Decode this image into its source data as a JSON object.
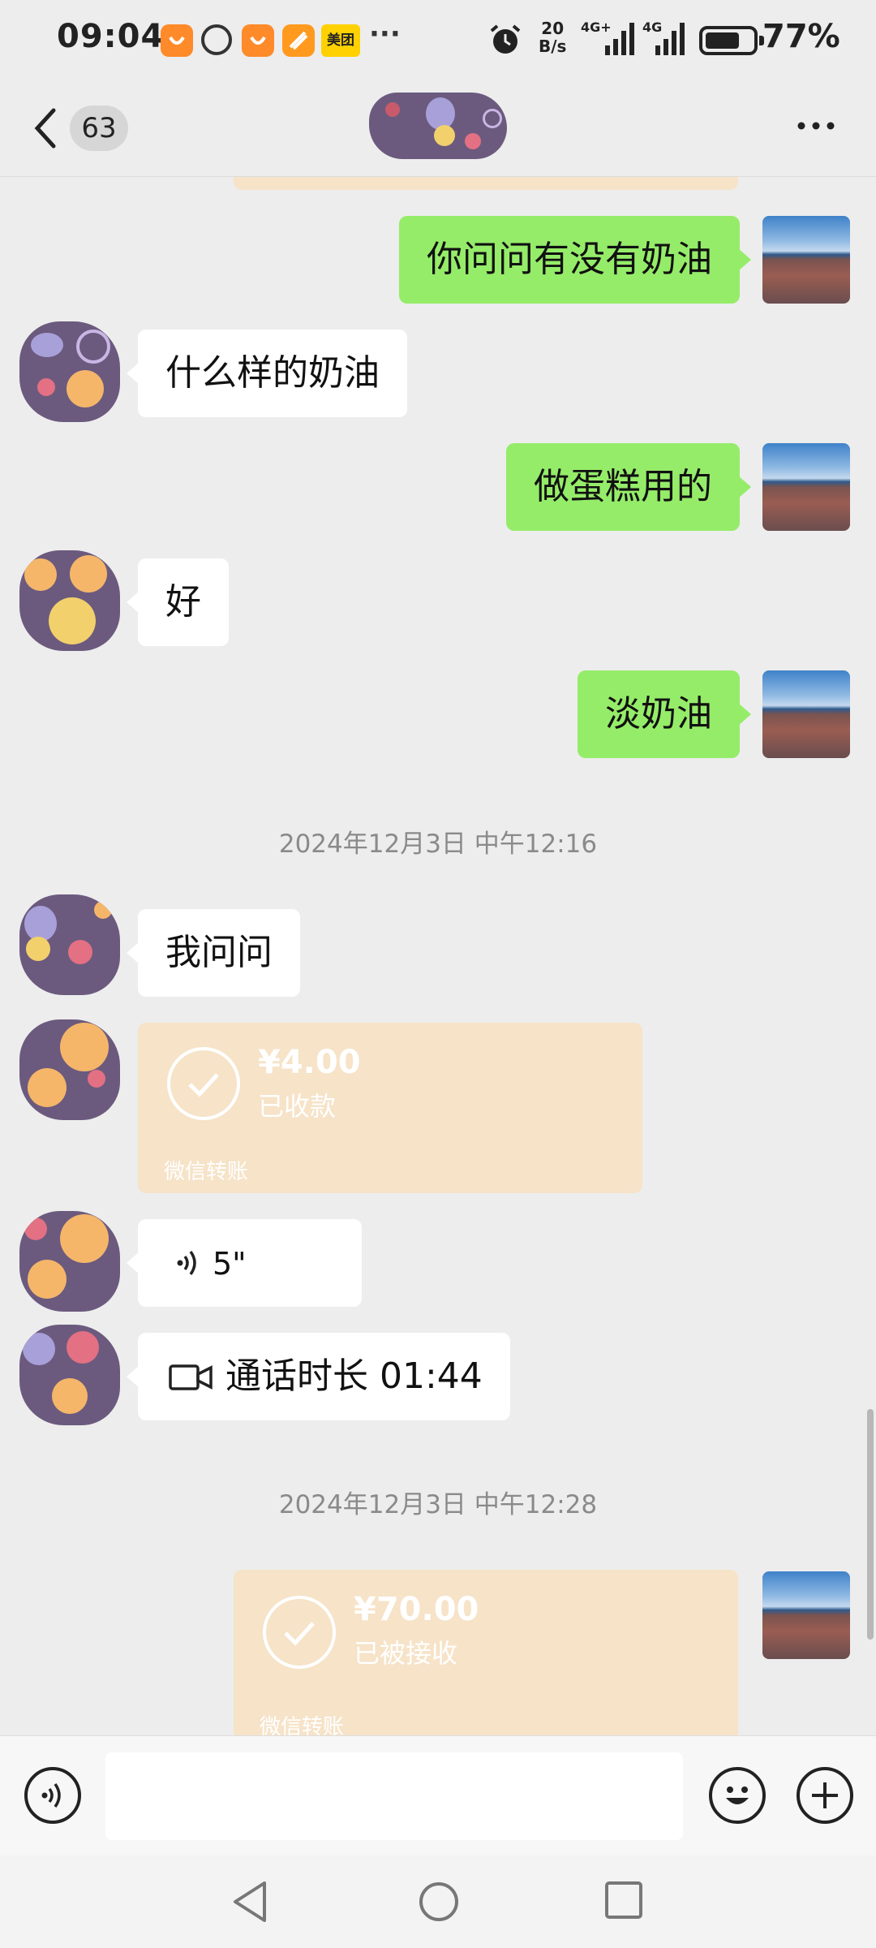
{
  "status_bar": {
    "time": "09:04",
    "dots": "···",
    "net_speed_value": "20",
    "net_speed_unit": "B/s",
    "network_1": "4G+",
    "network_2": "4G",
    "battery_percent_text": "77%",
    "battery_level": 0.77,
    "meituan_label": "美团"
  },
  "header": {
    "unread_count": "63"
  },
  "messages": {
    "m1": "你问问有没有奶油",
    "m2": "什么样的奶油",
    "m3": "做蛋糕用的",
    "m4": "好",
    "m5": "淡奶油",
    "ts1": "2024年12月3日 中午12:16",
    "m6": "我问问",
    "transfer1": {
      "amount": "¥4.00",
      "status": "已收款",
      "label": "微信转账"
    },
    "voice": {
      "duration": "5\""
    },
    "call": {
      "text": "通话时长 01:44"
    },
    "ts2": "2024年12月3日 中午12:28",
    "transfer2": {
      "amount": "¥70.00",
      "status": "已被接收",
      "label": "微信转账"
    }
  },
  "input": {
    "placeholder": ""
  },
  "colors": {
    "me_bubble": "#95ec69",
    "them_bubble": "#ffffff",
    "transfer": "#f6e3c8",
    "background": "#ededed"
  }
}
